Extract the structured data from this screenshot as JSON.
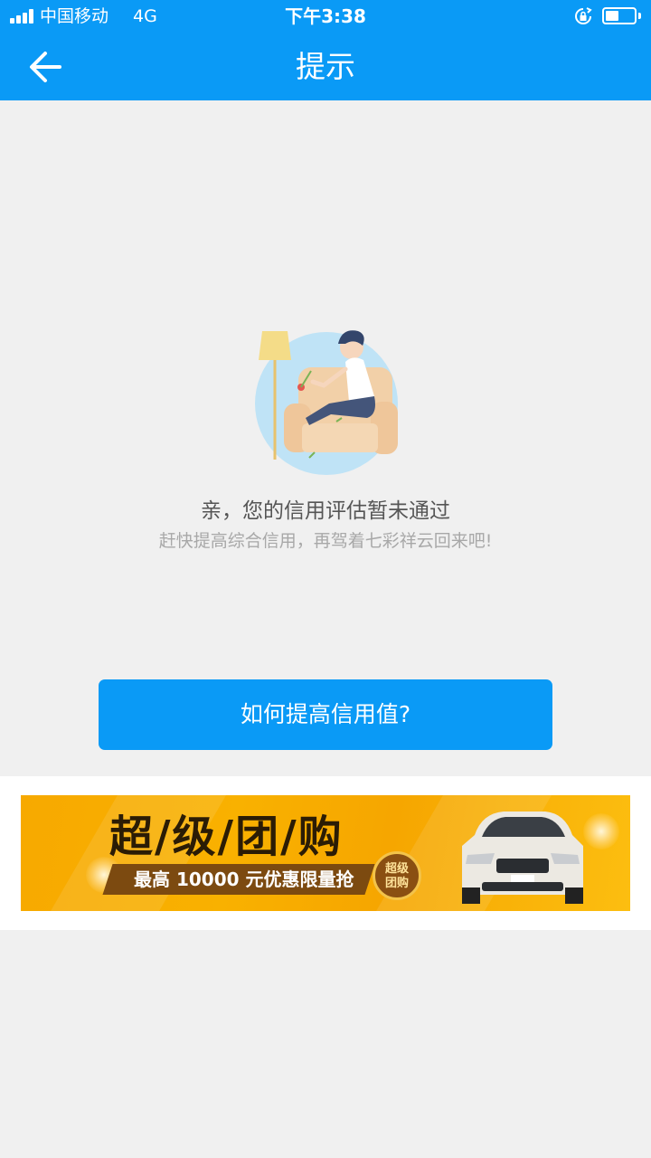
{
  "status_bar": {
    "carrier": "中国移动",
    "network": "4G",
    "time": "下午3:38",
    "signal_bars": 4,
    "battery_level": 0.45
  },
  "navbar": {
    "title": "提示",
    "back_icon": "back-arrow-icon"
  },
  "result": {
    "illustration": "person-on-sofa-illustration",
    "message": "亲，您的信用评估暂未通过",
    "submessage": "赶快提高综合信用，再驾着七彩祥云回来吧!"
  },
  "cta": {
    "label": "如何提高信用值?"
  },
  "banner": {
    "title": "超/级/团/购",
    "subtitle": "最高 10000 元优惠限量抢",
    "badge_line1": "超级",
    "badge_line2": "团购",
    "image": "car-photo"
  },
  "colors": {
    "accent": "#0a9af6",
    "background": "#f0f0f0",
    "banner_yellow": "#f9b100"
  }
}
